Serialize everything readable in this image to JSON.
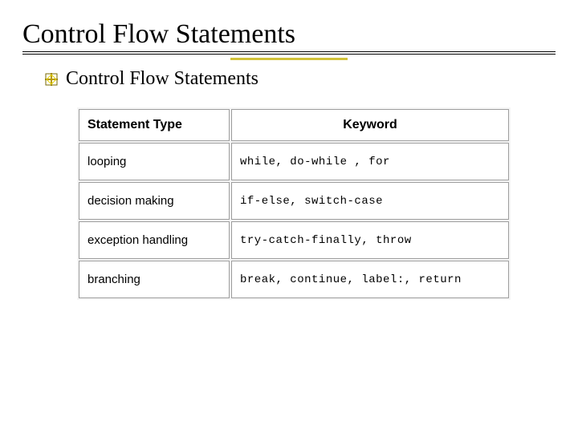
{
  "title": "Control Flow Statements",
  "bullet": "Control Flow Statements",
  "table": {
    "headers": {
      "type": "Statement Type",
      "keyword": "Keyword"
    },
    "rows": [
      {
        "type": "looping",
        "keyword": "while, do-while , for"
      },
      {
        "type": "decision making",
        "keyword": "if-else, switch-case"
      },
      {
        "type": "exception handling",
        "keyword": "try-catch-finally, throw"
      },
      {
        "type": "branching",
        "keyword": "break, continue, label:, return"
      }
    ]
  }
}
